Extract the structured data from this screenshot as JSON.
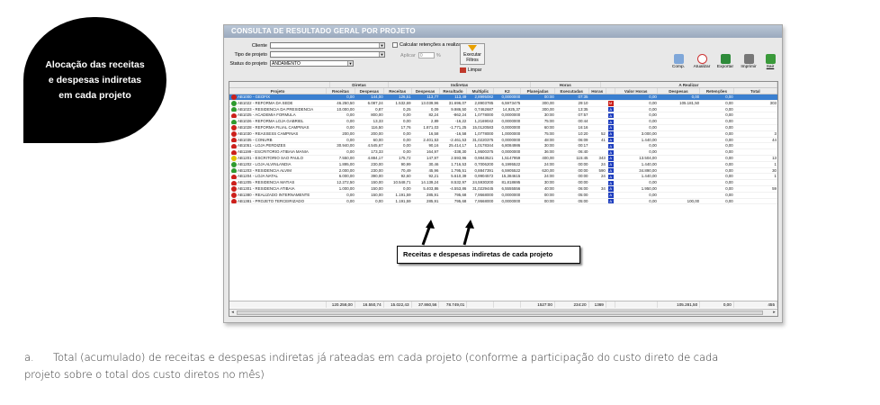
{
  "bubble": {
    "line1": "Alocação das receitas",
    "line2": "e despesas indiretas",
    "line3": "em cada projeto"
  },
  "window": {
    "title": "CONSULTA DE RESULTADO GERAL POR PROJETO"
  },
  "filters": {
    "cliente_label": "Cliente",
    "tipo_label": "Tipo de projeto",
    "status_label": "Status do projeto",
    "status_value": "ANDAMENTO",
    "calc_label": "Calcular retenções a realizar",
    "aplicar_label": "Aplicar",
    "aplicar_value": "0",
    "pct": "%",
    "executar_label1": "Executar",
    "executar_label2": "Filtros",
    "limpar_label": "Limpar"
  },
  "toolbar": {
    "comp": "Comp.",
    "atualizar": "Atualizar",
    "exportar": "Exportar",
    "imprimir": "Imprimir",
    "sair": "Sair"
  },
  "groups": {
    "diretas": "Diretas",
    "indiretas": "Indiretas",
    "horas": "Horas",
    "a_realizar": "A Realizar"
  },
  "columns": [
    "Projeto",
    "Receitas",
    "Despesas",
    "Receitas",
    "Despesas",
    "Resultado",
    "Multiplic",
    "K2",
    "Planejadas",
    "Executadas",
    "Horas",
    "",
    "Valor Horas",
    "Despesas",
    "Retenções",
    "Total"
  ],
  "rows": [
    {
      "status": "red",
      "projeto": "AB1000 - GEOFIX",
      "c": [
        "0,00",
        "144,00",
        "126,51",
        "113,77",
        "113,49",
        "2,8995082",
        "0,0000000",
        "00:00",
        "07:35",
        "",
        "",
        "0,00",
        "0,00",
        "0,00",
        ""
      ],
      "sel": true
    },
    {
      "status": "green",
      "projeto": "AB1022 - REFORMA DA SEDE",
      "c": [
        "46.250,50",
        "6.087,24",
        "1.532,69",
        "13.039,96",
        "31.696,07",
        "2,8903785",
        "6,5973475",
        "300,00",
        "29:10",
        "",
        "M",
        "0,00",
        "105.181,50",
        "0,00",
        "303"
      ]
    },
    {
      "status": "green",
      "projeto": "AB1023 - RESIDENCIA DA PRESIDENCIA",
      "c": [
        "10.000,00",
        "0,87",
        "0,25",
        "0,09",
        "9.986,50",
        "0,7462687",
        "14,925,37",
        "300,00",
        "13:35",
        "",
        "A",
        "0,00",
        "",
        "0,00",
        ""
      ]
    },
    {
      "status": "red",
      "projeto": "AB1025 - ACADEMIA FORMULA",
      "c": [
        "0,00",
        "800,00",
        "0,00",
        "82,24",
        "-862,24",
        "1,0778000",
        "0,0000000",
        "30:00",
        "07:57",
        "",
        "A",
        "0,00",
        "",
        "0,00",
        ""
      ]
    },
    {
      "status": "green",
      "projeto": "AB1026 - REFORMA LOJA GABRIEL",
      "c": [
        "0,00",
        "13,33",
        "0,00",
        "2,89",
        "-16,22",
        "1,2169042",
        "0,0000000",
        "75:00",
        "00:44",
        "",
        "A",
        "0,00",
        "",
        "0,00",
        ""
      ]
    },
    {
      "status": "red",
      "projeto": "AB1028 - REFORMA FILIAL CAMPINAS",
      "c": [
        "0,00",
        "116,50",
        "17,76",
        "1.871,03",
        "-1.771,25",
        "15,0120583",
        "0,0000000",
        "60:00",
        "16:16",
        "",
        "A",
        "0,00",
        "",
        "0,00",
        ""
      ]
    },
    {
      "status": "red",
      "projeto": "AB1030 - REASSESS CAMPINAS",
      "c": [
        "200,00",
        "200,00",
        "0,00",
        "16,58",
        "-16,58",
        "1,0778000",
        "1,0000000",
        "75:00",
        "10:20",
        "52",
        "A",
        "3.000,00",
        "",
        "0,00",
        "3"
      ]
    },
    {
      "status": "red",
      "projeto": "AB1035 - CONURB",
      "c": [
        "0,00",
        "60,00",
        "0,00",
        "2.401,53",
        "-2.461,53",
        "31,0220375",
        "0,0000000",
        "48:00",
        "06:09",
        "41",
        "A",
        "1.440,00",
        "",
        "0,00",
        "44"
      ]
    },
    {
      "status": "red",
      "projeto": "AB1051 - LOJA PERDIZES",
      "c": [
        "30.940,00",
        "4.545,67",
        "0,00",
        "90,16",
        "25.414,17",
        "1,0178344",
        "6,8084986",
        "30:00",
        "00:17",
        "",
        "A",
        "0,00",
        "",
        "0,00",
        ""
      ]
    },
    {
      "status": "red",
      "projeto": "AB1199 - ESCRITORIO ATIBAIA MANIA",
      "c": [
        "0,00",
        "173,33",
        "0,00",
        "164,97",
        "-338,30",
        "1,9500375",
        "0,0000000",
        "36:00",
        "06:40",
        "",
        "A",
        "0,00",
        "",
        "0,00",
        ""
      ]
    },
    {
      "status": "yellow",
      "projeto": "AB1201 - ESCRITORIO SAO PAULO",
      "c": [
        "7.550,00",
        "4.884,17",
        "175,72",
        "147,97",
        "2.593,96",
        "0,9843521",
        "1,5147959",
        "400,00",
        "115:45",
        "343",
        "A",
        "13.504,00",
        "",
        "0,00",
        "13"
      ]
    },
    {
      "status": "green",
      "projeto": "AB1202 - LOJA ALVINLANDIA",
      "c": [
        "1.895,00",
        "230,00",
        "90,99",
        "30,46",
        "1.716,53",
        "0,7006200",
        "6,1995522",
        "24:00",
        "00:00",
        "24",
        "A",
        "1.440,00",
        "",
        "0,00",
        "1"
      ]
    },
    {
      "status": "green",
      "projeto": "AB1203 - RESIDENCIA ALVIM",
      "c": [
        "2.000,00",
        "230,00",
        "70,49",
        "45,96",
        "1.795,51",
        "0,8847391",
        "6,5905522",
        "620,00",
        "00:00",
        "590",
        "A",
        "34.890,00",
        "",
        "0,00",
        "30"
      ]
    },
    {
      "status": "red",
      "projeto": "AB1204 - LOJA NATAL",
      "c": [
        "6.000,00",
        "390,00",
        "92,60",
        "92,21",
        "5.610,39",
        "0,9904572",
        "15,384615",
        "24:00",
        "00:00",
        "24",
        "A",
        "1.440,00",
        "",
        "0,00",
        "1"
      ]
    },
    {
      "status": "red",
      "projeto": "AB1205 - RESIDENCIA MATIAS",
      "c": [
        "12.272,50",
        "150,00",
        "10.548,71",
        "14.139,24",
        "8.532,97",
        "24,5930200",
        "81,818695",
        "30:00",
        "00:00",
        "",
        "A",
        "0,00",
        "",
        "0,00",
        ""
      ]
    },
    {
      "status": "red",
      "projeto": "AB1301 - RESIDENCIA ATIBAIA",
      "c": [
        "1.000,00",
        "150,00",
        "0,00",
        "5.403,86",
        "-4.553,86",
        "31,0229445",
        "6,5555556",
        "40:00",
        "06:00",
        "34",
        "A",
        "1.950,00",
        "",
        "0,00",
        "59"
      ]
    },
    {
      "status": "red",
      "projeto": "AB1380 - REALIZADO INTERNAMENTE",
      "c": [
        "0,00",
        "150,00",
        "1.191,59",
        "285,91",
        "795,68",
        "7,9568000",
        "0,0000000",
        "00:00",
        "05:00",
        "",
        "A",
        "0,00",
        "",
        "0,00",
        ""
      ]
    },
    {
      "status": "red",
      "projeto": "AB1381 - PROJETO TERCEIRIZADO",
      "c": [
        "0,00",
        "0,00",
        "1.191,59",
        "285,91",
        "795,68",
        "7,9568000",
        "0,0000000",
        "00:00",
        "05:00",
        "",
        "A",
        "0,00",
        "100,00",
        "0,00",
        ""
      ]
    }
  ],
  "totals": [
    "120.258,00",
    "16.550,74",
    "15.022,43",
    "37.860,56",
    "78.749,01",
    "",
    "",
    "1527:00",
    "234:20",
    "1369",
    "",
    "",
    "105.281,50",
    "0,00",
    "455"
  ],
  "callout": "Receitas e despesas indiretas de cada projeto",
  "caption": {
    "label": "a.",
    "line1": "Total (acumulado) de receitas e despesas indiretas já rateadas em cada projeto (conforme a participação do custo direto de cada",
    "line2": "projeto sobre o total dos custo diretos no mês)"
  },
  "colors": {
    "selected_row": "#3a7fd0",
    "status_red": "#cc1f1a",
    "status_green": "#2e9a2e",
    "status_yellow": "#e0c000",
    "badge_blue": "#1f3fbf",
    "badge_red": "#cc1f1a"
  }
}
